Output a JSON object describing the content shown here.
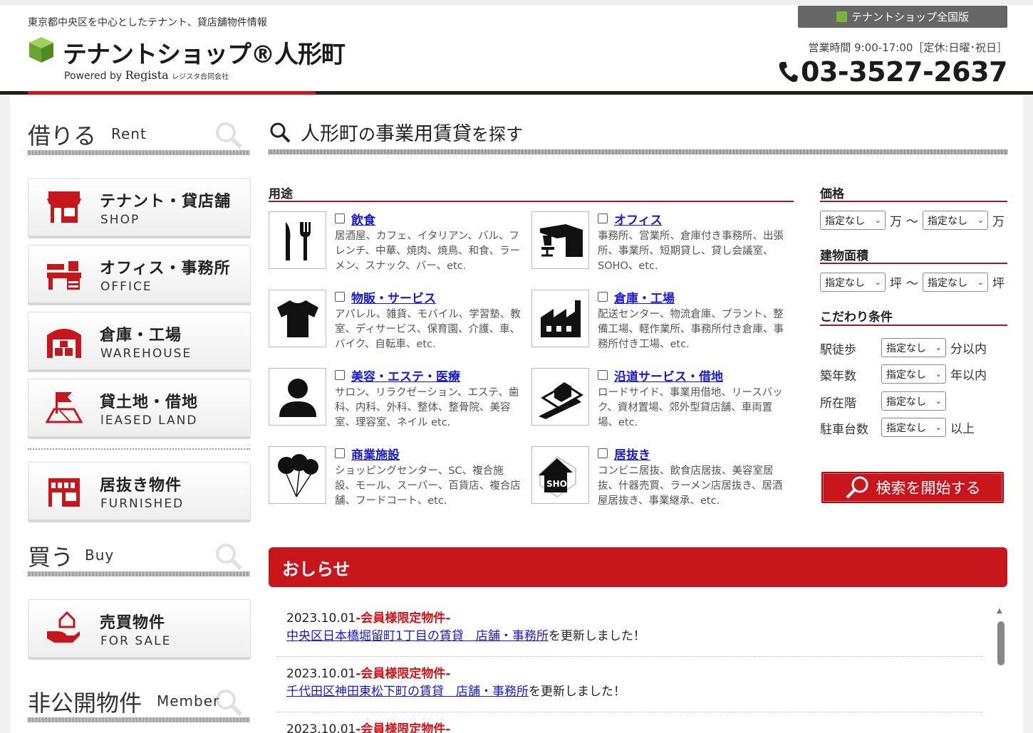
{
  "header": {
    "tagline": "東京都中央区を中心としたテナント、貸店舗物件情報",
    "logo_text": "テナントショップ®人形町",
    "powered_prefix": "Powered by",
    "powered_brand": "Regista",
    "powered_company": "レジスタ合同会社",
    "national_button": "テナントショップ全国版",
    "hours": "営業時間 9:00-17:00［定休:日曜･祝日］",
    "tel": "03-3527-2637",
    "colors": {
      "accent": "#c8161d",
      "logo_green": "#7ab53a",
      "link": "#1a1ad0"
    }
  },
  "sidebar": {
    "rent_jp": "借りる",
    "rent_en": "Rent",
    "buy_jp": "買う",
    "buy_en": "Buy",
    "member_jp": "非公開物件",
    "member_en": "Member",
    "items": [
      {
        "title": "テナント・貸店舗",
        "sub": "SHOP",
        "icon": "shop-icon"
      },
      {
        "title": "オフィス・事務所",
        "sub": "OFFICE",
        "icon": "office-icon"
      },
      {
        "title": "倉庫・工場",
        "sub": "WAREHOUSE",
        "icon": "warehouse-icon"
      },
      {
        "title": "貸土地・借地",
        "sub": "lEASED LAND",
        "icon": "land-flag-icon"
      },
      {
        "title": "居抜き物件",
        "sub": "FURNISHED",
        "icon": "furnished-store-icon"
      },
      {
        "title": "売買物件",
        "sub": "FOR SALE",
        "icon": "house-hand-icon"
      }
    ]
  },
  "main": {
    "title_a": "人形町",
    "title_b": "の",
    "title_c": "事業用賃貸",
    "title_d": "を探す",
    "usage_label": "用途",
    "usages": [
      {
        "name": "飲食",
        "desc": "居酒屋、カフェ、イタリアン、バル、フレンチ、中華、焼肉、焼鳥、和食、ラーメン、スナック、バー、etc.",
        "icon": "fork-knife-icon"
      },
      {
        "name": "オフィス",
        "desc": "事務所、営業所、倉庫付き事務所、出張所、事業所、短期貸し、貸し会議室、SOHO、etc.",
        "icon": "office-desk-icon"
      },
      {
        "name": "物販・サービス",
        "desc": "アパレル、雑貨、モバイル、学習塾、教室、ディサービス、保育園、介護、車、バイク、自転車、etc.",
        "icon": "tshirt-icon"
      },
      {
        "name": "倉庫・工場",
        "desc": "配送センター、物流倉庫、プラント、整備工場、軽作業所、事務所付き倉庫、事務所付き工場、etc.",
        "icon": "factory-icon"
      },
      {
        "name": "美容・エステ・医療",
        "desc": "サロン、リラクゼーション、エステ、歯科、内科、外科、整体、整骨院、美容室、理容室、ネイル etc.",
        "icon": "person-icon"
      },
      {
        "name": "沿道サービス・借地",
        "desc": "ロードサイド、事業用借地、リースバック、資材置場、郊外型貸店舗、車両置場、etc.",
        "icon": "roadside-icon"
      },
      {
        "name": "商業施設",
        "desc": "ショッピングセンター、SC、複合施設、モール、スーパー、百貨店、複合店舗、フードコート、etc.",
        "icon": "balloons-icon"
      },
      {
        "name": "居抜き",
        "desc": "コンビニ居抜、飲食店居抜、美容室居抜、什器売買、ラーメン店居抜き、居酒屋居抜き、事業継承、etc.",
        "icon": "shop-house-icon"
      }
    ],
    "price_label": "価格",
    "area_label": "建物面積",
    "cond_label": "こだわり条件",
    "unnamed": "指定なし",
    "man": "万",
    "tsubo": "坪",
    "tilde": "〜",
    "conds": [
      {
        "label": "駅徒歩",
        "suffix": "分以内"
      },
      {
        "label": "築年数",
        "suffix": "年以内"
      },
      {
        "label": "所在階",
        "suffix": ""
      },
      {
        "label": "駐車台数",
        "suffix": "以上"
      }
    ],
    "search_button": "検索を開始する"
  },
  "news": {
    "title": "おしらせ",
    "items": [
      {
        "date": "2023.10.01",
        "tag": "-会員様限定物件-",
        "link": "中央区日本橋堀留町1丁目の賃貸　店舗・事務所",
        "after": "を更新しました！"
      },
      {
        "date": "2023.10.01",
        "tag": "-会員様限定物件-",
        "link": "千代田区神田東松下町の賃貸　店舗・事務所",
        "after": "を更新しました！"
      },
      {
        "date": "2023.10.01",
        "tag": "-会員様限定物件-",
        "link": "",
        "after": ""
      }
    ]
  }
}
